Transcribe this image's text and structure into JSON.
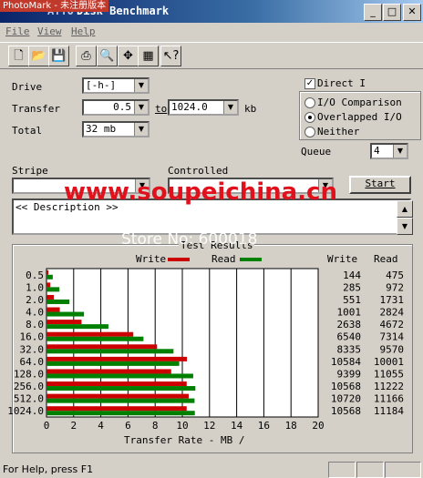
{
  "photomark": "PhotoMark - 未注册版本",
  "window": {
    "title_fragment": "Disk Benchmark",
    "title_prefix": "ATTO"
  },
  "menu": {
    "items": [
      "File",
      "View",
      "Help"
    ]
  },
  "controls": {
    "drive_label": "Drive",
    "drive_value": "[-h-]",
    "transfer_label": "Transfer",
    "transfer_from": "0.5",
    "transfer_to_word": "to",
    "transfer_to": "1024.0",
    "transfer_unit": "kb",
    "total_label": "Total",
    "total_value": "32 mb",
    "direct_io_label": "Direct I",
    "radio_io_comparison": "I/O Comparison",
    "radio_overlapped": "Overlapped I/O",
    "radio_neither": "Neither",
    "queue_label": "Queue",
    "queue_value": "4",
    "stripe_label": "Stripe",
    "controlled_label": "Controlled",
    "start_label": "Start",
    "description_label": "<< Description >>"
  },
  "watermarks": {
    "url": "www.soupeichina.cn",
    "store": "Store No: 600018"
  },
  "chart_data": {
    "type": "bar",
    "title": "Test Results",
    "xlabel": "Transfer Rate - MB /",
    "xlim": [
      0,
      20
    ],
    "xticks": [
      "0",
      "2",
      "4",
      "6",
      "8",
      "10",
      "12",
      "14",
      "16",
      "18",
      "20"
    ],
    "categories": [
      "0.5",
      "1.0",
      "2.0",
      "4.0",
      "8.0",
      "16.0",
      "32.0",
      "64.0",
      "128.0",
      "256.0",
      "512.0",
      "1024.0"
    ],
    "series": [
      {
        "name": "Write",
        "color": "#cc0000",
        "values": [
          0.14,
          0.28,
          0.54,
          0.98,
          2.58,
          6.39,
          8.14,
          10.34,
          9.18,
          10.32,
          10.47,
          10.32
        ]
      },
      {
        "name": "Read",
        "color": "#008000",
        "values": [
          0.46,
          0.95,
          1.69,
          2.76,
          4.56,
          7.14,
          9.35,
          9.77,
          10.8,
          10.96,
          10.9,
          10.92
        ]
      }
    ],
    "table_headers": [
      "Write",
      "Read"
    ],
    "write_values": [
      "144",
      "285",
      "551",
      "1001",
      "2638",
      "6540",
      "8335",
      "10584",
      "9399",
      "10568",
      "10720",
      "10568"
    ],
    "read_values": [
      "475",
      "972",
      "1731",
      "2824",
      "4672",
      "7314",
      "9570",
      "10001",
      "11055",
      "11222",
      "11166",
      "11184"
    ],
    "grid": true,
    "legend": "top"
  },
  "status": {
    "help_text": "For Help, press F1"
  }
}
